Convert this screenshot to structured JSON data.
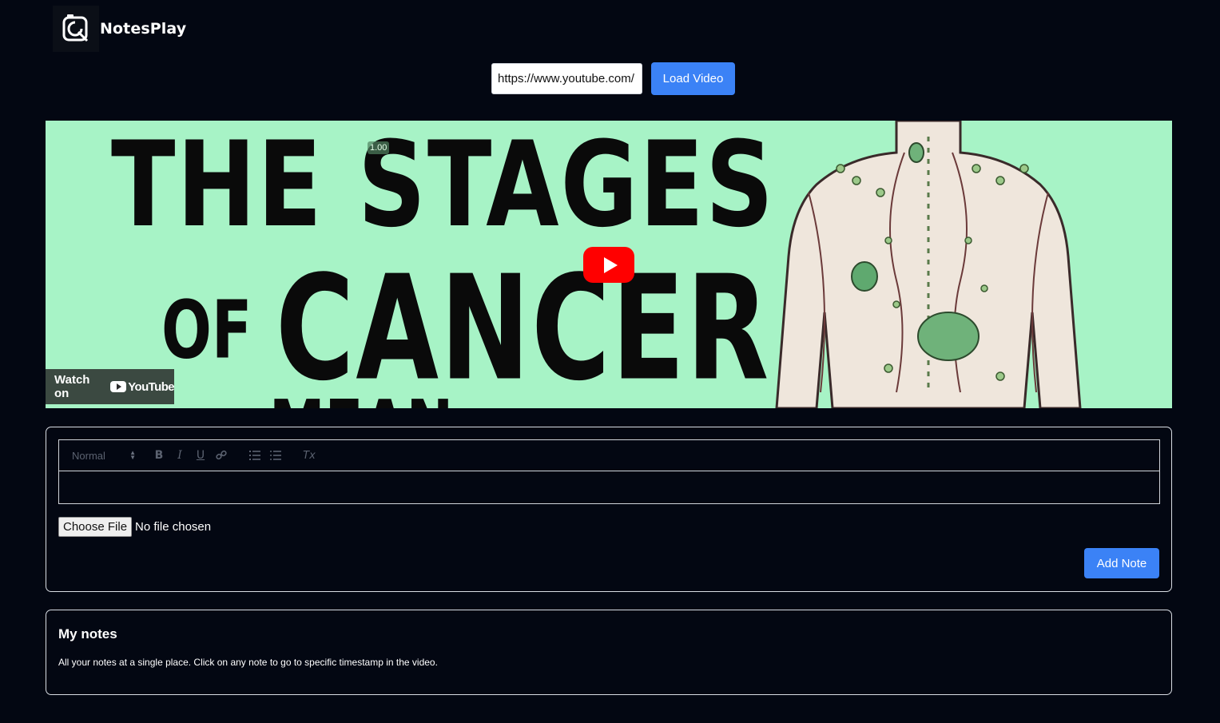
{
  "app": {
    "title": "NotesPlay",
    "logo_icon": "camera-edit-logo-icon"
  },
  "url_bar": {
    "value": "https://www.youtube.com/",
    "load_label": "Load Video",
    "accent": "#3b82f6"
  },
  "video": {
    "thumbnail_lines": [
      "THE STAGES",
      "OF",
      "CANCER",
      "MEAN"
    ],
    "speed_badge": "1.00",
    "watch_on_label": "Watch on",
    "youtube_label": "YouTube",
    "thumbnail_bg": "#a7f3c6",
    "play_color": "#ff0000"
  },
  "editor": {
    "format_select": "Normal",
    "toolbar_icons": [
      "bold-icon",
      "italic-icon",
      "underline-icon",
      "link-icon",
      "ordered-list-icon",
      "bullet-list-icon",
      "clear-format-icon"
    ],
    "toolbar_glyphs": {
      "bold": "B",
      "italic": "I",
      "underline": "U",
      "link": "🔗",
      "ordered_list": "≡",
      "bullet_list": "☰",
      "clear_format": "Tx"
    },
    "file_button": "Choose File",
    "file_status": "No file chosen",
    "add_label": "Add Note"
  },
  "notes": {
    "title": "My notes",
    "description": "All your notes at a single place. Click on any note to go to specific timestamp in the video."
  }
}
